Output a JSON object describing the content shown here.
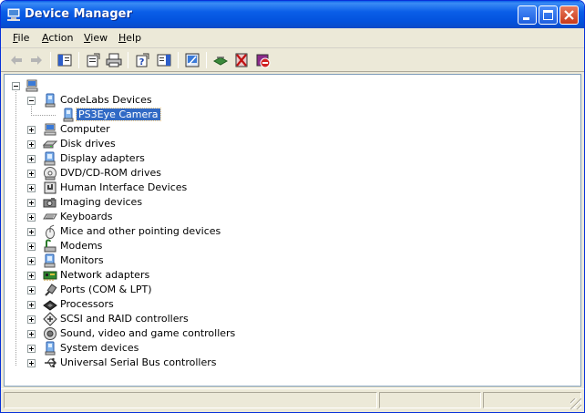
{
  "window": {
    "title": "Device Manager",
    "title_icon": "computer-manage-icon"
  },
  "menu": [
    {
      "label": "File"
    },
    {
      "label": "Action"
    },
    {
      "label": "View"
    },
    {
      "label": "Help"
    }
  ],
  "toolbar": {
    "buttons": [
      {
        "icon": "back-arrow-icon"
      },
      {
        "icon": "forward-arrow-icon"
      },
      {
        "icon": "show-hide-console-tree-icon"
      },
      {
        "icon": "properties-icon"
      },
      {
        "icon": "print-icon"
      },
      {
        "icon": "help-icon"
      },
      {
        "icon": "show-hide-action-pane-icon"
      },
      {
        "icon": "scan-hardware-changes-icon"
      },
      {
        "icon": "update-driver-icon"
      },
      {
        "icon": "uninstall-icon"
      },
      {
        "icon": "disable-icon"
      }
    ]
  },
  "tree": {
    "root": {
      "icon": "computer-icon"
    },
    "categories": [
      {
        "label": "CodeLabs Devices",
        "expanded": true,
        "icon": "device-icon",
        "children": [
          {
            "label": "PS3Eye Camera",
            "selected": true,
            "icon": "device-icon"
          }
        ]
      },
      {
        "label": "Computer",
        "icon": "computer-icon"
      },
      {
        "label": "Disk drives",
        "icon": "disk-drive-icon"
      },
      {
        "label": "Display adapters",
        "icon": "display-adapter-icon"
      },
      {
        "label": "DVD/CD-ROM drives",
        "icon": "cdrom-icon"
      },
      {
        "label": "Human Interface Devices",
        "icon": "hid-icon"
      },
      {
        "label": "Imaging devices",
        "icon": "camera-icon"
      },
      {
        "label": "Keyboards",
        "icon": "keyboard-icon"
      },
      {
        "label": "Mice and other pointing devices",
        "icon": "mouse-icon"
      },
      {
        "label": "Modems",
        "icon": "modem-icon"
      },
      {
        "label": "Monitors",
        "icon": "monitor-icon"
      },
      {
        "label": "Network adapters",
        "icon": "network-adapter-icon"
      },
      {
        "label": "Ports (COM & LPT)",
        "icon": "port-icon"
      },
      {
        "label": "Processors",
        "icon": "processor-icon"
      },
      {
        "label": "SCSI and RAID controllers",
        "icon": "scsi-icon"
      },
      {
        "label": "Sound, video and game controllers",
        "icon": "sound-icon"
      },
      {
        "label": "System devices",
        "icon": "system-device-icon"
      },
      {
        "label": "Universal Serial Bus controllers",
        "icon": "usb-icon"
      }
    ]
  },
  "colors": {
    "title_blue": "#0a5ee8",
    "selection": "#316ac5",
    "chrome": "#ece9d8"
  }
}
